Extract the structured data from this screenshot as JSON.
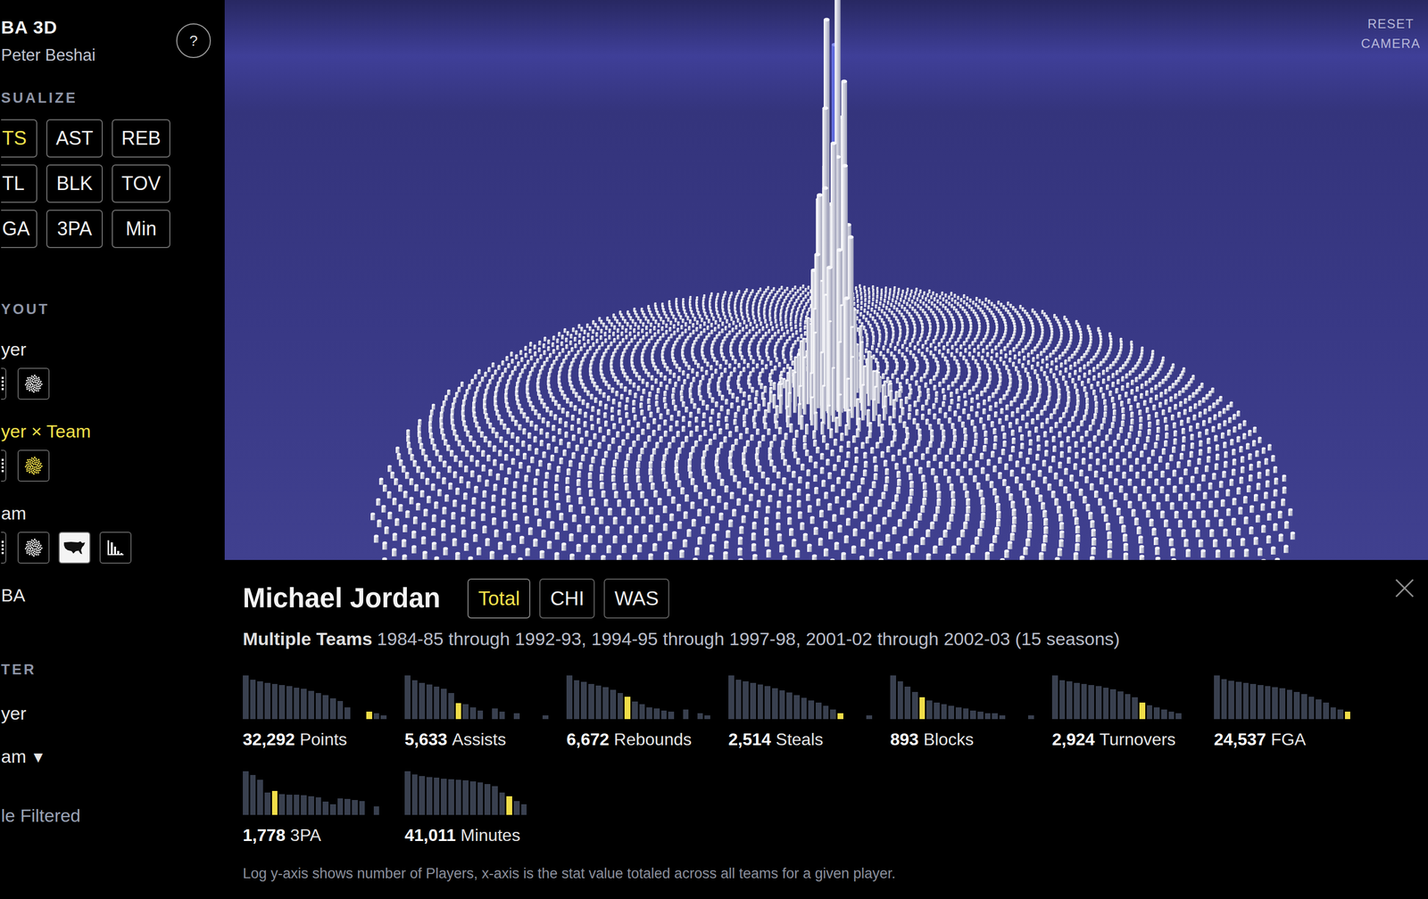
{
  "sidebar": {
    "title": "BA 3D",
    "subtitle": "Peter Beshai",
    "help": "?",
    "visualize_header": "SUALIZE",
    "stats": [
      {
        "label": "TS",
        "selected": true
      },
      {
        "label": "AST",
        "selected": false
      },
      {
        "label": "REB",
        "selected": false
      },
      {
        "label": "TL",
        "selected": false
      },
      {
        "label": "BLK",
        "selected": false
      },
      {
        "label": "TOV",
        "selected": false
      },
      {
        "label": "GA",
        "selected": false
      },
      {
        "label": "3PA",
        "selected": false
      },
      {
        "label": "Min",
        "selected": false
      }
    ],
    "layout_header": "YOUT",
    "layouts": [
      {
        "label": "yer",
        "selected": false,
        "icons": [
          {
            "kind": "list",
            "selected": false
          },
          {
            "kind": "dots",
            "selected": false
          }
        ]
      },
      {
        "label": "yer × Team",
        "selected": true,
        "icons": [
          {
            "kind": "list",
            "selected": false
          },
          {
            "kind": "dots",
            "selected": true
          }
        ]
      },
      {
        "label": "am",
        "selected": false,
        "icons": [
          {
            "kind": "list",
            "selected": false
          },
          {
            "kind": "dots",
            "selected": false
          },
          {
            "kind": "map",
            "selected": false
          },
          {
            "kind": "bars",
            "selected": false
          }
        ]
      },
      {
        "label": "BA",
        "selected": false,
        "icons": []
      }
    ],
    "filter_header": "TER",
    "filter_player": "yer",
    "filter_team": "am",
    "filter_caret": "▾",
    "filter_note": "le Filtered"
  },
  "viz": {
    "reset_camera": "RESET CAMERA",
    "spikes": [
      {
        "level": 1.02,
        "selected": false
      },
      {
        "level": 0.95,
        "selected": false
      },
      {
        "level": 0.62,
        "selected": false
      },
      {
        "level": 0.88,
        "selected": true
      },
      {
        "level": 0.74,
        "selected": false
      },
      {
        "level": 0.8,
        "selected": false
      },
      {
        "level": 0.58,
        "selected": false
      },
      {
        "level": 0.66,
        "selected": false
      },
      {
        "level": 0.7,
        "selected": false
      },
      {
        "level": 0.52,
        "selected": false
      },
      {
        "level": 0.6,
        "selected": false
      },
      {
        "level": 0.48,
        "selected": false
      },
      {
        "level": 0.55,
        "selected": false
      },
      {
        "level": 0.44,
        "selected": false
      },
      {
        "level": 0.5,
        "selected": false
      },
      {
        "level": 0.4,
        "selected": false
      },
      {
        "level": 0.46,
        "selected": false
      },
      {
        "level": 0.38,
        "selected": false
      },
      {
        "level": 0.42,
        "selected": false
      },
      {
        "level": 0.34,
        "selected": false
      },
      {
        "level": 0.36,
        "selected": false
      },
      {
        "level": 0.3,
        "selected": false
      },
      {
        "level": 0.33,
        "selected": false
      },
      {
        "level": 0.28,
        "selected": false
      }
    ]
  },
  "player": {
    "name": "Michael Jordan",
    "tabs": [
      {
        "label": "Total",
        "selected": true
      },
      {
        "label": "CHI",
        "selected": false
      },
      {
        "label": "WAS",
        "selected": false
      }
    ],
    "teams_label": "Multiple Teams",
    "seasons": "1984-85 through 1992-93, 1994-95 through 1997-98, 2001-02 through 2002-03 (15 seasons)",
    "stats": [
      {
        "value": "32,292",
        "label": "Points",
        "highlight": 17,
        "bins": [
          3000,
          1400,
          1000,
          800,
          650,
          520,
          420,
          330,
          250,
          180,
          120,
          80,
          45,
          28,
          8,
          0,
          0,
          3,
          2,
          1
        ]
      },
      {
        "value": "5,633",
        "label": "Assists",
        "highlight": 7,
        "bins": [
          3000,
          1200,
          800,
          550,
          380,
          250,
          120,
          17,
          15,
          8,
          4,
          0,
          6,
          3,
          0,
          2,
          0,
          0,
          0,
          1
        ]
      },
      {
        "value": "6,672",
        "label": "Rebounds",
        "highlight": 8,
        "bins": [
          3000,
          1300,
          900,
          650,
          480,
          350,
          220,
          120,
          60,
          25,
          15,
          8,
          6,
          4,
          3,
          0,
          5,
          0,
          2,
          1
        ]
      },
      {
        "value": "2,514",
        "label": "Steals",
        "highlight": 15,
        "bins": [
          3000,
          1400,
          1000,
          750,
          580,
          420,
          300,
          200,
          130,
          80,
          50,
          30,
          20,
          10,
          5,
          2,
          0,
          0,
          0,
          1
        ]
      },
      {
        "value": "893",
        "label": "Blocks",
        "highlight": 4,
        "bins": [
          3000,
          1000,
          400,
          150,
          55,
          30,
          20,
          15,
          10,
          8,
          6,
          4,
          3,
          2,
          2,
          1,
          0,
          0,
          0,
          1
        ]
      },
      {
        "value": "2,924",
        "label": "Turnovers",
        "highlight": 12,
        "bins": [
          3000,
          1300,
          1000,
          800,
          650,
          520,
          420,
          320,
          230,
          160,
          100,
          55,
          20,
          12,
          8,
          5,
          3,
          2,
          0,
          0
        ]
      },
      {
        "value": "24,537",
        "label": "FGA",
        "highlight": 18,
        "bins": [
          3000,
          1500,
          1100,
          900,
          750,
          620,
          520,
          430,
          350,
          280,
          210,
          150,
          100,
          60,
          35,
          20,
          8,
          5,
          3,
          0
        ]
      },
      {
        "value": "1,778",
        "label": "3PA",
        "highlight": 4,
        "bins": [
          3000,
          1500,
          600,
          60,
          80,
          45,
          40,
          38,
          35,
          30,
          25,
          10,
          6,
          20,
          18,
          15,
          12,
          0,
          4,
          0
        ]
      },
      {
        "value": "41,011",
        "label": "Minutes",
        "highlight": 14,
        "bins": [
          3000,
          1600,
          1200,
          1000,
          900,
          800,
          720,
          640,
          560,
          480,
          400,
          300,
          200,
          60,
          30,
          12,
          6,
          0,
          0,
          0
        ]
      }
    ],
    "footnote": "Log y-axis shows number of Players, x-axis is the stat value totaled across all teams for a given player."
  }
}
